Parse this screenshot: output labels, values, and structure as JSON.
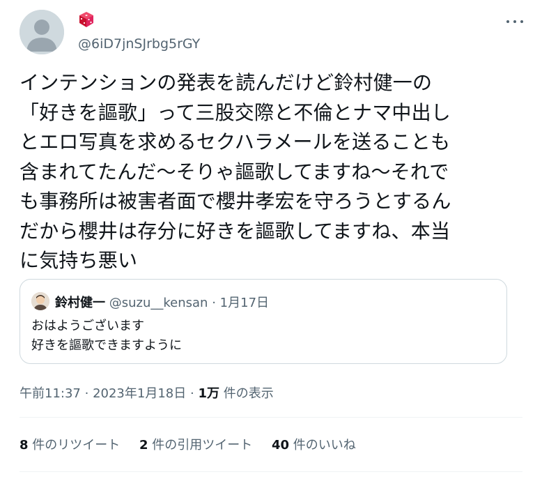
{
  "author": {
    "handle": "@6iD7jnSJrbg5rGY",
    "display_name_icon": "red-dice-emoji"
  },
  "tweet": {
    "lines": [
      "インテンションの発表を読んだけど鈴村健一の",
      "「好きを謳歌」って三股交際と不倫とナマ中出し",
      "とエロ写真を求めるセクハラメールを送ることも",
      "含まれてたんだ〜そりゃ謳歌してますね〜それで",
      "も事務所は被害者面で櫻井孝宏を守ろうとするん",
      "だから櫻井は存分に好きを謳歌してますね、本当",
      "に気持ち悪い"
    ]
  },
  "quote": {
    "name": "鈴村健一",
    "handle": "@suzu__kensan",
    "separator": "·",
    "date": "1月17日",
    "lines": [
      "おはようございます",
      "好きを謳歌できますように"
    ]
  },
  "meta": {
    "time": "午前11:37",
    "sep1": "·",
    "date": "2023年1月18日",
    "sep2": "·",
    "views_count": "1万",
    "views_label": "件の表示"
  },
  "stats": {
    "retweets_count": "8",
    "retweets_label": "件のリツイート",
    "quotes_count": "2",
    "quotes_label": "件の引用ツイート",
    "likes_count": "40",
    "likes_label": "件のいいね"
  },
  "colors": {
    "text": "#0f1419",
    "secondary": "#536471",
    "border": "#cfd9de",
    "dice": "#e0245e"
  }
}
